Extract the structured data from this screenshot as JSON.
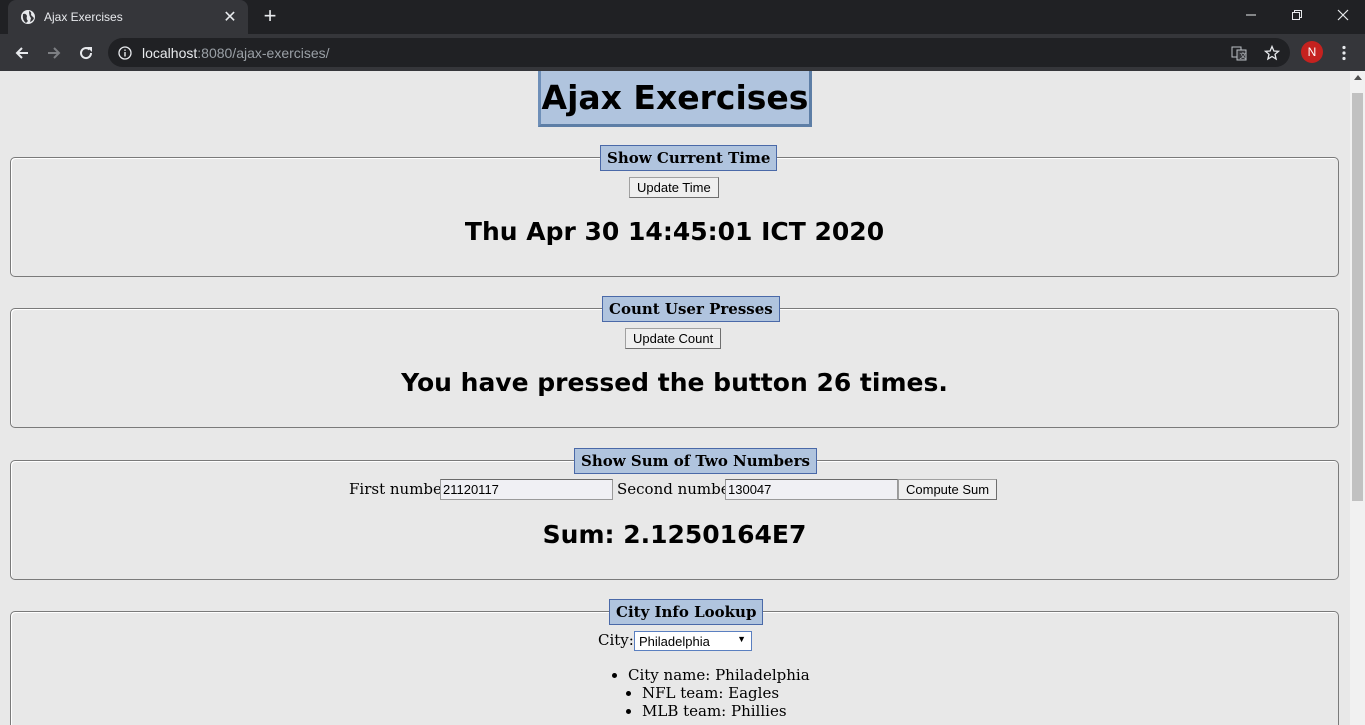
{
  "browser": {
    "tab_title": "Ajax Exercises",
    "url_host": "localhost",
    "url_path": ":8080/ajax-exercises/",
    "profile_initial": "N"
  },
  "page": {
    "title": "Ajax Exercises",
    "time_section": {
      "legend": "Show Current Time",
      "button": "Update Time",
      "result": "Thu Apr 30 14:45:01 ICT 2020"
    },
    "count_section": {
      "legend": "Count User Presses",
      "button": "Update Count",
      "result": "You have pressed the button 26 times."
    },
    "sum_section": {
      "legend": "Show Sum of Two Numbers",
      "first_label": "First number:",
      "first_value": "21120117",
      "second_label": "Second number:",
      "second_value": "130047",
      "button": "Compute Sum",
      "result": "Sum: 2.1250164E7"
    },
    "city_section": {
      "legend": "City Info Lookup",
      "city_label": "City:",
      "selected_city": "Philadelphia",
      "info": [
        "City name: Philadelphia",
        "NFL team: Eagles",
        "MLB team: Phillies"
      ]
    }
  }
}
